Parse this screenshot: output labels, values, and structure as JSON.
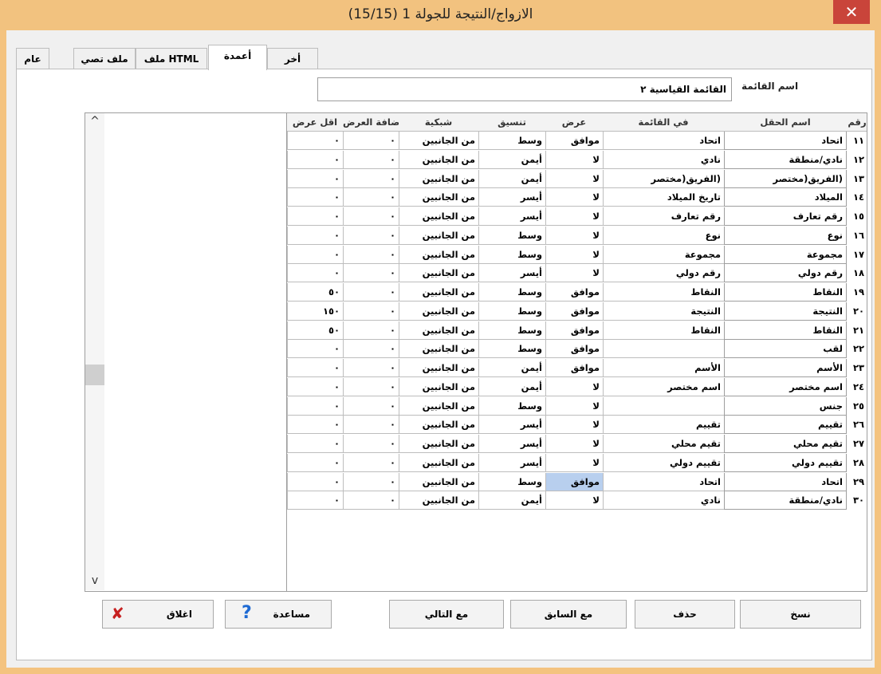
{
  "window": {
    "title": "(15/15) الازواج/النتيجة للجولة 1",
    "close_icon": "✕"
  },
  "tabs": [
    {
      "label": "عام",
      "active": false
    },
    {
      "label": "ملف تصي",
      "active": false
    },
    {
      "label": "ملف HTML",
      "active": false
    },
    {
      "label": "أعمدة",
      "active": true
    },
    {
      "label": "أخر",
      "active": false
    }
  ],
  "list_name": {
    "label": "اسم القائمة",
    "value": "القائمة القياسية ٢"
  },
  "table": {
    "headers": {
      "num": "رقم",
      "field": "اسم الحقل",
      "inlist": "في القائمة",
      "display": "عرض",
      "align": "تنسيق",
      "grid": "شبكية",
      "add": "اضافة العرض",
      "minw": "اقل عرض"
    },
    "rows": [
      {
        "num": "١١",
        "field": "اتحاد",
        "inlist": "اتحاد",
        "display": "موافق",
        "align": "وسط",
        "grid": "من الجانبين",
        "add": "٠",
        "minw": "٠"
      },
      {
        "num": "١٢",
        "field": "نادي/منطقة",
        "inlist": "نادي",
        "display": "لا",
        "align": "أيمن",
        "grid": "من الجانبين",
        "add": "٠",
        "minw": "٠"
      },
      {
        "num": "١٣",
        "field": "(الفريق(مختصر",
        "inlist": "(الفريق(مختصر",
        "display": "لا",
        "align": "أيمن",
        "grid": "من الجانبين",
        "add": "٠",
        "minw": "٠"
      },
      {
        "num": "١٤",
        "field": "الميلاد",
        "inlist": "تاريخ الميلاد",
        "display": "لا",
        "align": "أيسر",
        "grid": "من الجانبين",
        "add": "٠",
        "minw": "٠"
      },
      {
        "num": "١٥",
        "field": "رقم تعارف",
        "inlist": "رقم تعارف",
        "display": "لا",
        "align": "أيسر",
        "grid": "من الجانبين",
        "add": "٠",
        "minw": "٠"
      },
      {
        "num": "١٦",
        "field": "نوع",
        "inlist": "نوع",
        "display": "لا",
        "align": "وسط",
        "grid": "من الجانبين",
        "add": "٠",
        "minw": "٠"
      },
      {
        "num": "١٧",
        "field": "مجموعة",
        "inlist": "مجموعة",
        "display": "لا",
        "align": "وسط",
        "grid": "من الجانبين",
        "add": "٠",
        "minw": "٠"
      },
      {
        "num": "١٨",
        "field": "رقم دولي",
        "inlist": "رقم دولي",
        "display": "لا",
        "align": "أيسر",
        "grid": "من الجانبين",
        "add": "٠",
        "minw": "٠"
      },
      {
        "num": "١٩",
        "field": "النقاط",
        "inlist": "النقاط",
        "display": "موافق",
        "align": "وسط",
        "grid": "من الجانبين",
        "add": "٠",
        "minw": "٥٠"
      },
      {
        "num": "٢٠",
        "field": "النتيجة",
        "inlist": "النتيجة",
        "display": "موافق",
        "align": "وسط",
        "grid": "من الجانبين",
        "add": "٠",
        "minw": "١٥٠"
      },
      {
        "num": "٢١",
        "field": "النقاط",
        "inlist": "النقاط",
        "display": "موافق",
        "align": "وسط",
        "grid": "من الجانبين",
        "add": "٠",
        "minw": "٥٠"
      },
      {
        "num": "٢٢",
        "field": "لقب",
        "inlist": "",
        "display": "موافق",
        "align": "وسط",
        "grid": "من الجانبين",
        "add": "٠",
        "minw": "٠"
      },
      {
        "num": "٢٣",
        "field": "الأسم",
        "inlist": "الأسم",
        "display": "موافق",
        "align": "أيمن",
        "grid": "من الجانبين",
        "add": "٠",
        "minw": "٠"
      },
      {
        "num": "٢٤",
        "field": "اسم مختصر",
        "inlist": "اسم مختصر",
        "display": "لا",
        "align": "أيمن",
        "grid": "من الجانبين",
        "add": "٠",
        "minw": "٠"
      },
      {
        "num": "٢٥",
        "field": "جنس",
        "inlist": "",
        "display": "لا",
        "align": "وسط",
        "grid": "من الجانبين",
        "add": "٠",
        "minw": "٠"
      },
      {
        "num": "٢٦",
        "field": "تقييم",
        "inlist": "تقييم",
        "display": "لا",
        "align": "أيسر",
        "grid": "من الجانبين",
        "add": "٠",
        "minw": "٠"
      },
      {
        "num": "٢٧",
        "field": "تقيم محلي",
        "inlist": "تقيم محلي",
        "display": "لا",
        "align": "أيسر",
        "grid": "من الجانبين",
        "add": "٠",
        "minw": "٠"
      },
      {
        "num": "٢٨",
        "field": "تقييم دولي",
        "inlist": "تقييم دولي",
        "display": "لا",
        "align": "أيسر",
        "grid": "من الجانبين",
        "add": "٠",
        "minw": "٠"
      },
      {
        "num": "٢٩",
        "field": "اتحاد",
        "inlist": "اتحاد",
        "display": "موافق",
        "align": "وسط",
        "grid": "من الجانبين",
        "add": "٠",
        "minw": "٠"
      },
      {
        "num": "٣٠",
        "field": "نادي/منطقة",
        "inlist": "نادي",
        "display": "لا",
        "align": "أيمن",
        "grid": "من الجانبين",
        "add": "٠",
        "minw": "٠"
      }
    ]
  },
  "scrollbar": {
    "up_arrow": "^",
    "down_arrow": "v"
  },
  "buttons": {
    "copy": "نسخ",
    "delete": "حذف",
    "with_prev": "مع السابق",
    "with_next": "مع التالي",
    "help": "مساعدة",
    "help_icon": "?",
    "close": "اغلاق",
    "close_icon": "✘"
  },
  "colors": {
    "title_bar": "#f2c27f",
    "close_button": "#c9443a",
    "selected_cell": "#b8cfee"
  }
}
